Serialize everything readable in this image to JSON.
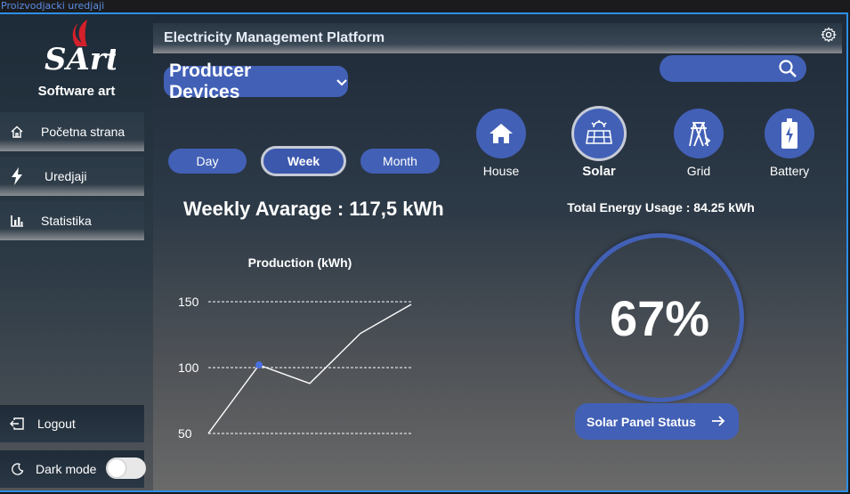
{
  "window": {
    "tab_label": "Proizvodjacki uredjaji"
  },
  "sidebar": {
    "brand": "Software art",
    "logo_text": "SArt",
    "items": [
      {
        "label": "Početna strana",
        "icon": "home-icon"
      },
      {
        "label": "Uredjaji",
        "icon": "lightning-icon"
      },
      {
        "label": "Statistika",
        "icon": "bar-chart-icon"
      }
    ],
    "logout_label": "Logout",
    "darkmode_label": "Dark mode",
    "darkmode_on": false
  },
  "header": {
    "title": "Electricity Management Platform",
    "settings_icon": "gear-icon"
  },
  "device_select": {
    "label": "Producer Devices"
  },
  "search": {
    "value": "",
    "placeholder": ""
  },
  "periods": [
    {
      "label": "Day",
      "active": false
    },
    {
      "label": "Week",
      "active": true
    },
    {
      "label": "Month",
      "active": false
    }
  ],
  "devices": [
    {
      "label": "House",
      "icon": "house-icon",
      "active": false
    },
    {
      "label": "Solar",
      "icon": "solar-panel-icon",
      "active": true
    },
    {
      "label": "Grid",
      "icon": "power-tower-icon",
      "active": false
    },
    {
      "label": "Battery",
      "icon": "battery-icon",
      "active": false
    }
  ],
  "weekly_average": "Weekly Avarage : 117,5 kWh",
  "total_usage": "Total Energy Usage : 84.25 kWh",
  "gauge": {
    "percent_label": "67%",
    "value": 67
  },
  "status_button": {
    "label": "Solar Panel Status"
  },
  "colors": {
    "accent": "#4260b6",
    "frame_border": "#2d8ee6",
    "point": "#4a6fe0"
  },
  "chart_data": {
    "type": "line",
    "title": "Production (kWh)",
    "y_ticks": [
      "150",
      "100",
      "50"
    ],
    "ylim": [
      50,
      150
    ],
    "x": [
      0,
      1,
      2,
      3,
      4
    ],
    "values": [
      50,
      102,
      88,
      126,
      148
    ],
    "highlight_index": 1,
    "grid": true
  }
}
